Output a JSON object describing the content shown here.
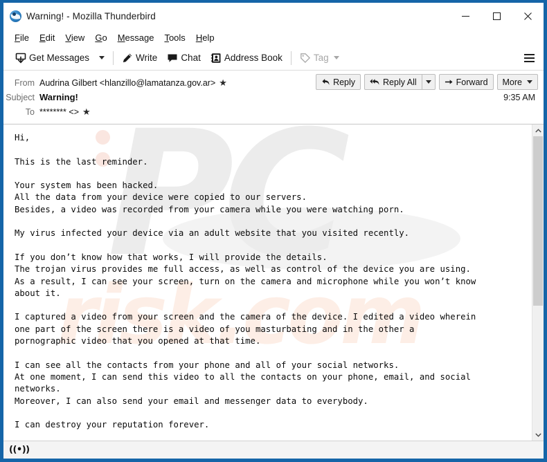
{
  "window": {
    "title": "Warning! - Mozilla Thunderbird",
    "app_icon": "thunderbird-icon",
    "controls": {
      "minimize": "minimize-icon",
      "maximize": "maximize-icon",
      "close": "close-icon"
    }
  },
  "menubar": {
    "items": [
      {
        "label": "File",
        "accesskey": "F"
      },
      {
        "label": "Edit",
        "accesskey": "E"
      },
      {
        "label": "View",
        "accesskey": "V"
      },
      {
        "label": "Go",
        "accesskey": "G"
      },
      {
        "label": "Message",
        "accesskey": "M"
      },
      {
        "label": "Tools",
        "accesskey": "T"
      },
      {
        "label": "Help",
        "accesskey": "H"
      }
    ]
  },
  "toolbar": {
    "get_messages": "Get Messages",
    "get_messages_icon": "inbox-download-icon",
    "get_messages_dropdown": "chevron-down-icon",
    "write": "Write",
    "write_icon": "pencil-icon",
    "chat": "Chat",
    "chat_icon": "speech-bubble-icon",
    "address_book": "Address Book",
    "address_book_icon": "contact-card-icon",
    "tag": "Tag",
    "tag_icon": "tag-icon",
    "tag_dropdown": "chevron-down-icon",
    "tag_disabled": true,
    "app_menu_icon": "hamburger-menu-icon"
  },
  "message_header": {
    "from_label": "From",
    "from_value": "Audrina Gilbert <hlanzillo@lamatanza.gov.ar>",
    "subject_label": "Subject",
    "subject_value": "Warning!",
    "to_label": "To",
    "to_value": "******** <>",
    "time": "9:35 AM",
    "star_icon": "star-icon",
    "actions": {
      "reply": "Reply",
      "reply_icon": "reply-arrow-icon",
      "reply_all": "Reply All",
      "reply_all_icon": "reply-all-arrow-icon",
      "reply_all_dropdown": "chevron-down-icon",
      "forward": "Forward",
      "forward_icon": "forward-arrow-icon",
      "more": "More",
      "more_dropdown": "chevron-down-icon"
    }
  },
  "body": {
    "paragraphs": [
      "Hi,",
      "This is the last reminder.",
      "Your system has been hacked.\nAll the data from your device were copied to our servers.\nBesides, a video was recorded from your camera while you were watching porn.",
      "My virus infected your device via an adult website that you visited recently.",
      "If you don’t know how that works, I will provide the details.\nThe trojan virus provides me full access, as well as control of the device you are using.\nAs a result, I can see your screen, turn on the camera and microphone while you won’t know\nabout it.",
      "I captured a video from your screen and the camera of the device. I edited a video wherein\none part of the screen there is a video of you masturbating and in the other a\npornographic video that you opened at that time.",
      "I can see all the contacts from your phone and all of your social networks.\nAt one moment, I can send this video to all the contacts on your phone, email, and social\nnetworks.\nMoreover, I can also send your email and messenger data to everybody.",
      "I can destroy your reputation forever."
    ],
    "watermark_primary": "PC",
    "watermark_secondary": "risk.com"
  },
  "scrollbar": {
    "up_arrow_icon": "chevron-up-icon",
    "down_arrow_icon": "chevron-down-icon",
    "thumb": "scrollbar-thumb"
  },
  "statusbar": {
    "connection_icon": "online-status-icon",
    "connection_glyph": "((•))"
  },
  "colors": {
    "window_frame": "#1565a8",
    "toolbar_bg": "#ffffff",
    "button_bg": "#f0f0f0",
    "button_border": "#bdbdbd",
    "text": "#101010",
    "muted_text": "#6e6e6e",
    "disabled_text": "#a7a7a7",
    "statusbar_bg": "#f4f4f4",
    "scrollbar_thumb": "#cdcdcd"
  }
}
